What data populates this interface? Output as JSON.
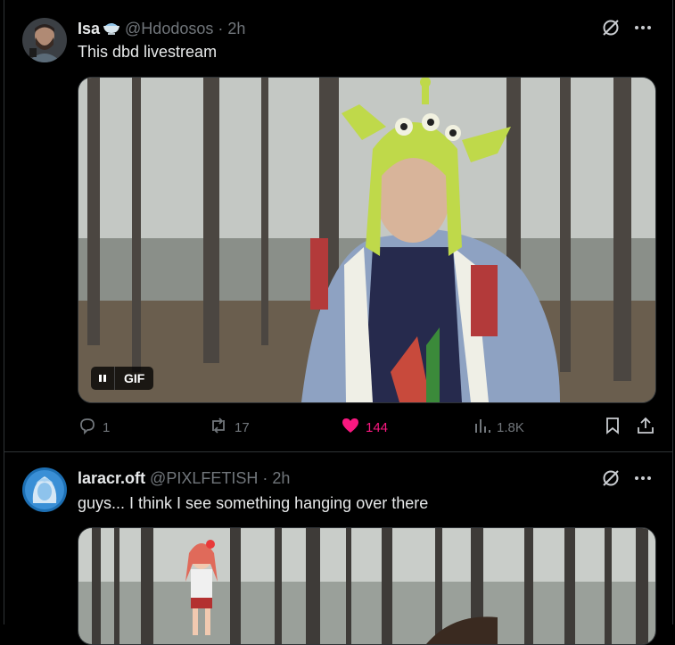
{
  "tweet1": {
    "display_name": "Isa",
    "handle": "@Hdodosos",
    "time": "· 2h",
    "text": "This dbd livestream",
    "media_badge": "GIF",
    "actions": {
      "replies": "1",
      "reposts": "17",
      "likes": "144",
      "views": "1.8K"
    },
    "like_color": "#f91880"
  },
  "tweet2": {
    "display_name": "laracr.oft",
    "handle": "@PIXLFETISH",
    "time": "· 2h",
    "text": "guys... I think I see something hanging over there"
  },
  "theme": {
    "background": "#000000",
    "muted": "#71767b",
    "border": "#2f3336"
  }
}
